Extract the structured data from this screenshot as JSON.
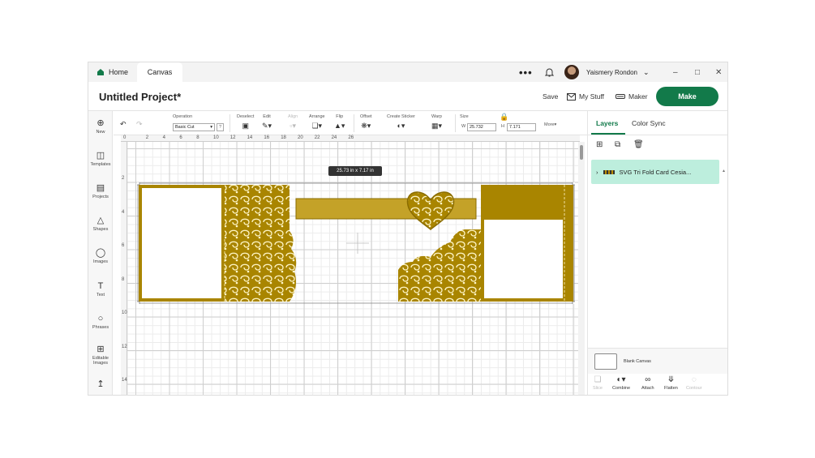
{
  "titlebar": {
    "tabs": [
      {
        "label": "Home",
        "icon": "home-icon"
      },
      {
        "label": "Canvas"
      }
    ],
    "more_label": "•••",
    "user_name": "Yaismery Rondon",
    "window_controls": {
      "minimize": "–",
      "maximize": "□",
      "close": "✕"
    }
  },
  "project": {
    "title": "Untitled Project*",
    "save_label": "Save",
    "mystuff_label": "My Stuff",
    "maker_label": "Maker",
    "make_label": "Make"
  },
  "colors": {
    "brand": "#127a4a",
    "design_gold": "#a98500",
    "layer_highlight": "#bdeedd"
  },
  "sidebar": {
    "items": [
      {
        "label": "New",
        "icon": "plus-circle-icon"
      },
      {
        "label": "Templates",
        "icon": "shirt-icon"
      },
      {
        "label": "Projects",
        "icon": "clipboard-icon"
      },
      {
        "label": "Shapes",
        "icon": "shapes-icon"
      },
      {
        "label": "Images",
        "icon": "lightbulb-icon"
      },
      {
        "label": "Text",
        "icon": "text-icon"
      },
      {
        "label": "Phrases",
        "icon": "speech-bubble-icon"
      },
      {
        "label": "Editable Images",
        "icon": "editable-image-icon"
      },
      {
        "label": "",
        "icon": "upload-icon"
      }
    ]
  },
  "toolbar": {
    "operation_label": "Operation",
    "operation_value": "Basic Cut",
    "deselect_label": "Deselect",
    "edit_label": "Edit",
    "align_label": "Align",
    "arrange_label": "Arrange",
    "flip_label": "Flip",
    "offset_label": "Offset",
    "create_sticker_label": "Create Sticker",
    "warp_label": "Warp",
    "size_label": "Size",
    "width_label": "W",
    "width_value": "25.732",
    "height_label": "H",
    "height_value": "7.171",
    "more_label": "More▾"
  },
  "canvas": {
    "ruler_top": [
      "0",
      "2",
      "4",
      "6",
      "8",
      "10",
      "12",
      "14",
      "16",
      "18",
      "20",
      "22",
      "24",
      "26"
    ],
    "ruler_left": [
      "2",
      "4",
      "6",
      "8",
      "10",
      "12",
      "14"
    ],
    "size_tooltip": "25.73  in x 7.17  in"
  },
  "right_panel": {
    "tabs": [
      "Layers",
      "Color Sync"
    ],
    "layer_name": "SVG Tri Fold Card Cesia...",
    "blank_canvas_label": "Blank Canvas",
    "bottom_tools": [
      "Slice",
      "Combine",
      "Attach",
      "Flatten",
      "Contour"
    ]
  }
}
